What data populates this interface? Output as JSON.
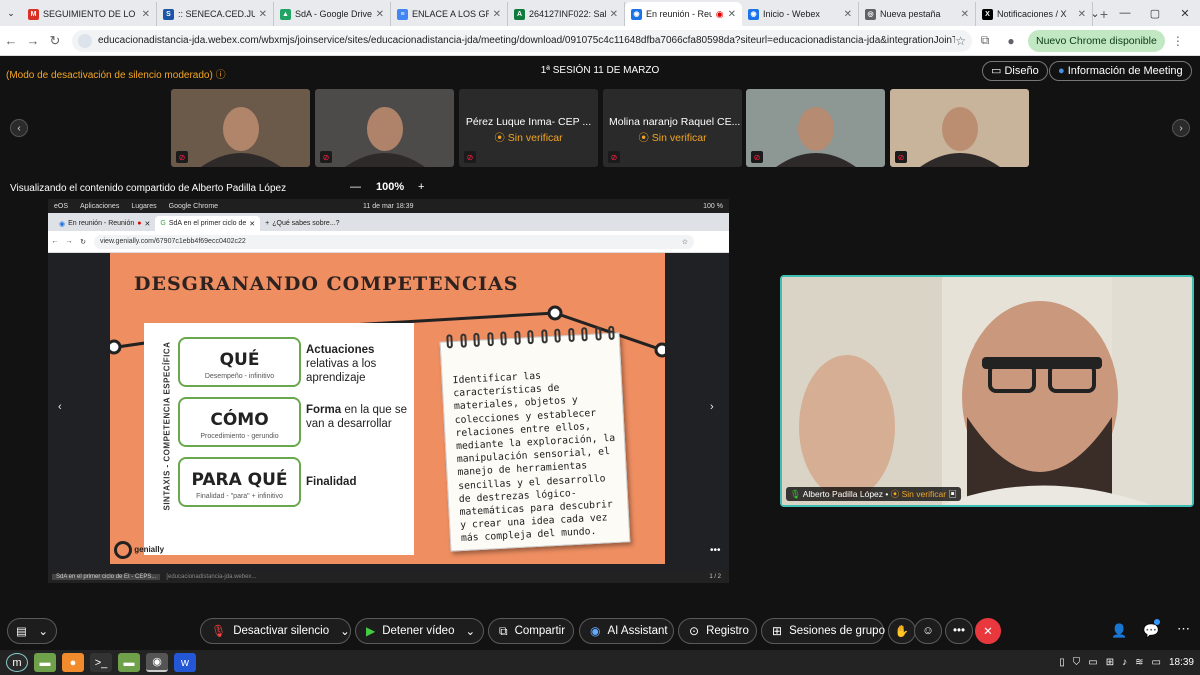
{
  "browser": {
    "tabs": [
      {
        "title": "SEGUIMIENTO DE LO",
        "favicon_color": "#d93025",
        "glyph": "M"
      },
      {
        "title": ":: SENECA.CED.JUNTA",
        "favicon_color": "#1a56a5",
        "glyph": "S"
      },
      {
        "title": "SdA - Google Drive",
        "favicon_color": "#1fa463",
        "glyph": "▲"
      },
      {
        "title": "ENLACE A LOS GRU",
        "favicon_color": "#4285f4",
        "glyph": "≡"
      },
      {
        "title": "264127INF022: Sala",
        "favicon_color": "#0f7b3c",
        "glyph": "A"
      },
      {
        "title": "En reunión - Reu",
        "favicon_color": "#1a73e8",
        "glyph": "◉",
        "active": true
      },
      {
        "title": "Inicio - Webex",
        "favicon_color": "#1a73e8",
        "glyph": "◉"
      },
      {
        "title": "Nueva pestaña",
        "favicon_color": "#5f6368",
        "glyph": "◎"
      },
      {
        "title": "Notificaciones / X",
        "favicon_color": "#000000",
        "glyph": "X"
      }
    ],
    "url": "educacionadistancia-jda.webex.com/wbxmjs/joinservice/sites/educacionadistancia-jda/meeting/download/091075c4c11648dfba7066cfa80598da?siteurl=educacionadistancia-jda&integrationJoinToken=QUhTSwAAAA...",
    "update_button": "Nuevo Chrome disponible"
  },
  "meeting": {
    "mute_note": "(Modo de desactivación de silencio moderado)",
    "session_title": "1ª SESIÓN 11 DE MARZO",
    "layout_button": "Diseño",
    "info_button": "Información de Meeting",
    "participants": [
      {
        "type": "video",
        "bg": "#6b5a4a"
      },
      {
        "type": "video",
        "bg": "#4d4b49"
      },
      {
        "type": "name",
        "name": "Pérez Luque Inma- CEP ...",
        "status": "Sin verificar"
      },
      {
        "type": "name",
        "name": "Molina naranjo Raquel CE...",
        "status": "Sin verificar"
      },
      {
        "type": "video",
        "bg": "#8d9794"
      },
      {
        "type": "video",
        "bg": "#c8b49a"
      }
    ],
    "sharing_text": "Visualizando el contenido compartido de Alberto Padilla López",
    "zoom": {
      "minus": "—",
      "value": "100%",
      "plus": "+"
    },
    "self_view": {
      "name": "Alberto Padilla López •",
      "status": "Sin verificar"
    }
  },
  "shared_screen": {
    "os_bar": {
      "os": "eOS",
      "menus": [
        "Aplicaciones",
        "Lugares",
        "Google Chrome"
      ],
      "clock": "11 de mar 18:39",
      "battery": "100 %"
    },
    "tabs": [
      "En reunión - Reunión",
      "SdA en el primer ciclo de",
      "¿Qué sabes sobre...?"
    ],
    "url": "view.genially.com/67907c1ebb4f69ecc0402c22",
    "slide": {
      "title": "DESGRANANDO COMPETENCIAS",
      "vertical": "SINTAXIS - COMPETENCIA ESPECÍFICA",
      "rows": [
        {
          "word": "QUÉ",
          "sub": "Desempeño - infinitivo",
          "desc_bold": "Actuaciones",
          "desc": " relativas a los aprendizaje"
        },
        {
          "word": "CÓMO",
          "sub": "Procedimiento - gerundio",
          "desc_bold": "Forma",
          "desc": " en la que se van a desarrollar"
        },
        {
          "word": "PARA QUÉ",
          "sub": "Finalidad - \"para\" + infinitivo",
          "desc_bold": "Finalidad",
          "desc": ""
        }
      ],
      "note": "Identificar las características de materiales, objetos y colecciones y establecer relaciones entre ellos, mediante la exploración, la manipulación sensorial, el manejo de herramientas sencillas y el desarrollo de destrezas lógico-matemáticas para descubrir y crear una idea cada vez más compleja del mundo.",
      "brand": "genially",
      "page": "1 / 2"
    },
    "taskbar": [
      "SdA en el primer ciclo de EI - CEPS...",
      "[educacionadistancia-jda.webex..."
    ]
  },
  "controls": {
    "mute": "Desactivar silencio",
    "video": "Detener vídeo",
    "share": "Compartir",
    "ai": "AI Assistant",
    "record": "Registro",
    "breakout": "Sesiones de grupo"
  },
  "system": {
    "time": "18:39"
  }
}
